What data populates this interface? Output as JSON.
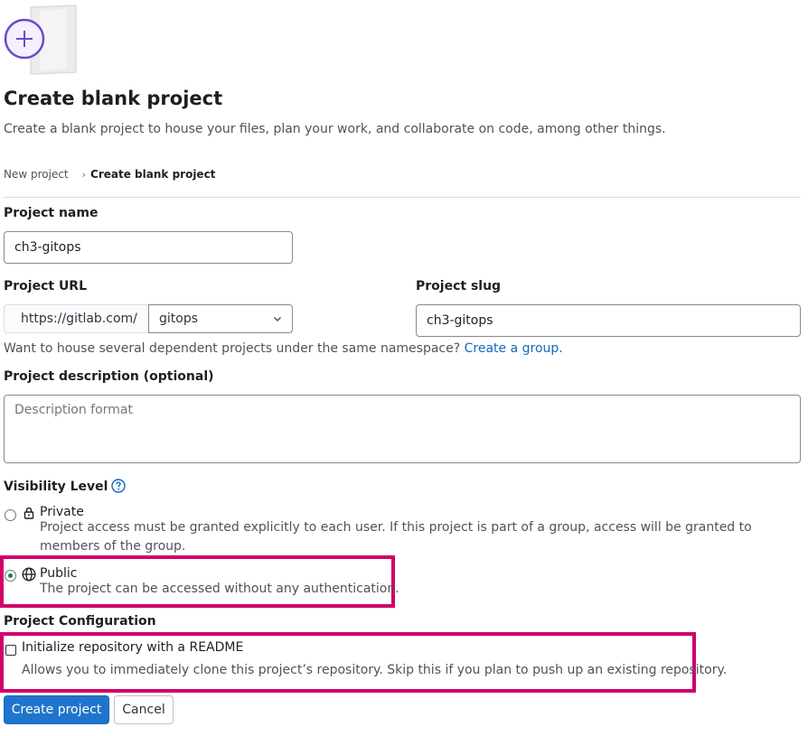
{
  "header": {
    "illustration_icon": "new-project-plus-illustration",
    "title": "Create blank project",
    "subtitle": "Create a blank project to house your files, plan your work, and collaborate on code, among other things."
  },
  "breadcrumb": {
    "parent": "New project",
    "separator": "›",
    "current": "Create blank project"
  },
  "form": {
    "project_name": {
      "label": "Project name",
      "value": "ch3-gitops"
    },
    "project_url": {
      "label": "Project URL",
      "prefix": "https://gitlab.com/",
      "namespace": "gitops"
    },
    "project_slug": {
      "label": "Project slug",
      "value": "ch3-gitops"
    },
    "namespace_help": {
      "text": "Want to house several dependent projects under the same namespace?",
      "link": "Create a group."
    },
    "description": {
      "label": "Project description (optional)",
      "placeholder": "Description format"
    },
    "visibility": {
      "label": "Visibility Level",
      "help_icon": "question-circle-icon",
      "options": [
        {
          "label": "Private",
          "icon": "lock-icon",
          "description": "Project access must be granted explicitly to each user. If this project is part of a group, access will be granted to members of the group.",
          "selected": false
        },
        {
          "label": "Public",
          "icon": "globe-icon",
          "description": "The project can be accessed without any authentication.",
          "selected": true
        }
      ]
    },
    "configuration": {
      "label": "Project Configuration",
      "readme": {
        "label": "Initialize repository with a README",
        "description": "Allows you to immediately clone this project’s repository. Skip this if you plan to push up an existing repository.",
        "checked": false
      }
    }
  },
  "actions": {
    "create": "Create project",
    "cancel": "Cancel"
  },
  "colors": {
    "primary": "#1f75cb",
    "link": "#1068bf",
    "highlight": "#d10069",
    "illustration_purple": "#6e49cb",
    "radio_selected": "#108548"
  }
}
